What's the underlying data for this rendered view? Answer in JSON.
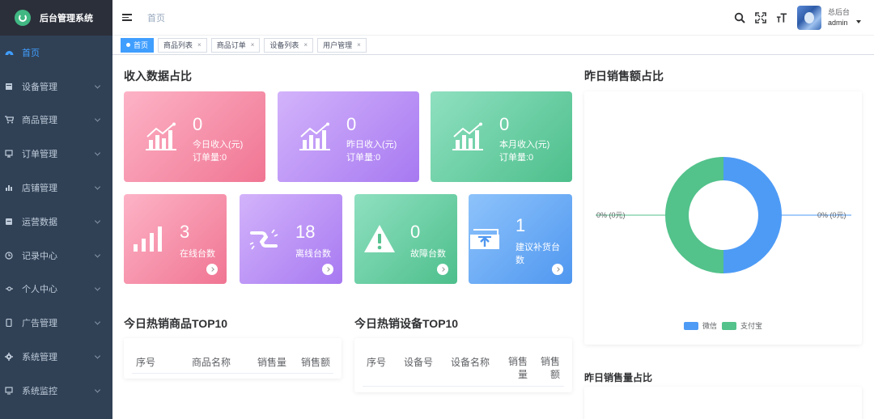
{
  "sidebar": {
    "title": "后台管理系统",
    "items": [
      {
        "label": "首页",
        "icon": "dashboard-icon",
        "active": true
      },
      {
        "label": "设备管理",
        "icon": "device-icon"
      },
      {
        "label": "商品管理",
        "icon": "cart-icon"
      },
      {
        "label": "订单管理",
        "icon": "order-icon"
      },
      {
        "label": "店铺管理",
        "icon": "shop-icon"
      },
      {
        "label": "运营数据",
        "icon": "data-icon"
      },
      {
        "label": "记录中心",
        "icon": "clock-icon"
      },
      {
        "label": "个人中心",
        "icon": "user-icon"
      },
      {
        "label": "广告管理",
        "icon": "ad-icon"
      },
      {
        "label": "系统管理",
        "icon": "gear-icon"
      },
      {
        "label": "系统监控",
        "icon": "monitor-icon"
      }
    ]
  },
  "header": {
    "breadcrumb": "首页",
    "user_role": "总后台",
    "user_name": "admin"
  },
  "tags": [
    {
      "label": "首页",
      "active": true
    },
    {
      "label": "商品列表"
    },
    {
      "label": "商品订单"
    },
    {
      "label": "设备列表"
    },
    {
      "label": "用户管理"
    }
  ],
  "income": {
    "title": "收入数据占比",
    "cards": [
      {
        "value": "0",
        "label": "今日收入(元)",
        "sub": "订单量:0"
      },
      {
        "value": "0",
        "label": "昨日收入(元)",
        "sub": "订单量:0"
      },
      {
        "value": "0",
        "label": "本月收入(元)",
        "sub": "订单量:0"
      }
    ]
  },
  "devices": {
    "cards": [
      {
        "value": "3",
        "label": "在线台数"
      },
      {
        "value": "18",
        "label": "离线台数"
      },
      {
        "value": "0",
        "label": "故障台数"
      },
      {
        "value": "1",
        "label": "建议补货台数"
      }
    ]
  },
  "hot_goods": {
    "title": "今日热销商品TOP10",
    "columns": [
      "序号",
      "商品名称",
      "销售量",
      "销售额"
    ]
  },
  "hot_devices": {
    "title": "今日热销设备TOP10",
    "columns": [
      "序号",
      "设备号",
      "设备名称",
      "销售量",
      "销售额"
    ]
  },
  "pie": {
    "title": "昨日销售额占比",
    "left_label": "0% (0元)",
    "right_label": "0% (0元)",
    "legend": [
      {
        "name": "微信",
        "color": "#4e9bf6"
      },
      {
        "name": "支付宝",
        "color": "#53c28b"
      }
    ]
  },
  "bottom_right_title": "昨日销售量占比",
  "chart_data": {
    "type": "pie",
    "title": "昨日销售额占比",
    "series": [
      {
        "name": "微信",
        "value": 0,
        "percent": 0,
        "label": "0% (0元)",
        "color": "#4e9bf6"
      },
      {
        "name": "支付宝",
        "value": 0,
        "percent": 0,
        "label": "0% (0元)",
        "color": "#53c28b"
      }
    ],
    "legend_position": "bottom-center",
    "donut": true
  }
}
